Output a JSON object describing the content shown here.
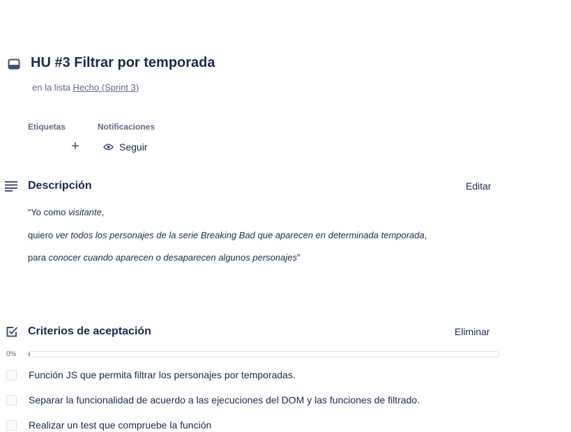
{
  "card": {
    "title": "HU #3 Filtrar por temporada",
    "list_prefix": "en la lista",
    "list_name": "Hecho (Sprint 3)"
  },
  "labels_section": {
    "label": "Etiquetas",
    "add": "+"
  },
  "notifications": {
    "label": "Notificaciones",
    "follow_label": "Seguir"
  },
  "description": {
    "title": "Descripción",
    "edit_label": "Editar",
    "line1": {
      "pre": "“Yo como ",
      "em": "visitante",
      "post": ","
    },
    "line2": {
      "pre": "quiero ",
      "em": "ver todos los personajes de la serie Breaking Bad que aparecen en determinada temporada",
      "post": ","
    },
    "line3": {
      "pre": "para ",
      "em": "conocer cuando aparecen o desaparecen algunos personajes",
      "post": "”"
    }
  },
  "checklist": {
    "title": "Criterios de aceptación",
    "delete_label": "Eliminar",
    "progress_text": "0%",
    "progress": 0,
    "items": [
      {
        "text": "Función JS que permita filtrar los personajes por temporadas.",
        "checked": false
      },
      {
        "text": "Separar la funcionalidad de acuerdo a las ejecuciones del DOM y las funciones de filtrado.",
        "checked": false
      },
      {
        "text": "Realizar un test que compruebe la función",
        "checked": false
      }
    ]
  },
  "colors": {
    "text": "#172b4d",
    "subtle": "#5e6c84",
    "progress": "#5ba4cf",
    "border": "#dfe1e6"
  },
  "icons": [
    "card-icon",
    "plus-icon",
    "eye-icon",
    "description-icon",
    "checklist-icon"
  ]
}
